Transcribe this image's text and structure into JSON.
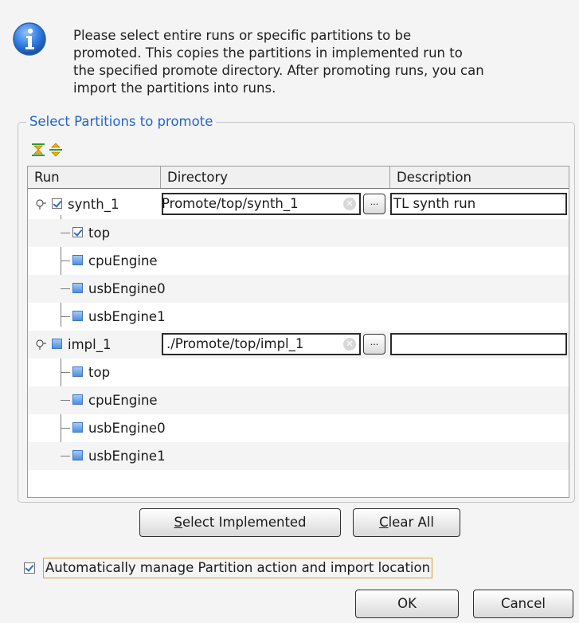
{
  "message": {
    "lines": [
      "Please select entire runs or specific partitions to be",
      "promoted. This copies the partitions in implemented run to",
      "the specified promote directory. After promoting runs, you can",
      "import the partitions into runs."
    ]
  },
  "group": {
    "title": "Select Partitions to promote",
    "expand_all_icon": "expand-all-icon",
    "collapse_all_icon": "collapse-all-icon"
  },
  "table": {
    "headers": {
      "run": "Run",
      "directory": "Directory",
      "description": "Description"
    },
    "runs": [
      {
        "name": "synth_1",
        "checked": true,
        "directory": "Promote/top/synth_1",
        "browse": "...",
        "description": "TL synth run",
        "partitions": [
          {
            "name": "top",
            "checked": true
          },
          {
            "name": "cpuEngine",
            "checked": false
          },
          {
            "name": "usbEngine0",
            "checked": false
          },
          {
            "name": "usbEngine1",
            "checked": false
          }
        ]
      },
      {
        "name": "impl_1",
        "checked": false,
        "directory": "./Promote/top/impl_1",
        "browse": "...",
        "description": "",
        "partitions": [
          {
            "name": "top",
            "checked": false
          },
          {
            "name": "cpuEngine",
            "checked": false
          },
          {
            "name": "usbEngine0",
            "checked": false
          },
          {
            "name": "usbEngine1",
            "checked": false
          }
        ]
      }
    ]
  },
  "buttons": {
    "select_implemented": {
      "mnemonic": "S",
      "rest": "elect Implemented"
    },
    "clear_all": {
      "mnemonic": "C",
      "rest": "lear All"
    },
    "ok": "OK",
    "cancel": "Cancel"
  },
  "auto_manage": {
    "checked": true,
    "label": "Automatically manage Partition action and import location"
  },
  "colors": {
    "accent": "#2266cc",
    "focus_border": "#d1a33c"
  }
}
